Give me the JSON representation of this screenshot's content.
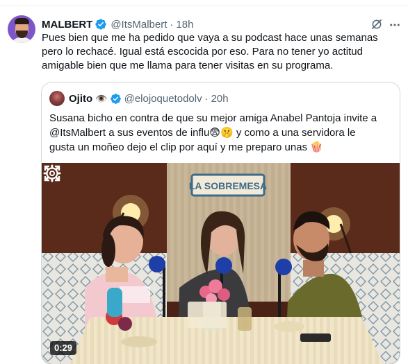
{
  "tweet": {
    "author_name": "MALBERT",
    "handle": "@ItsMalbert",
    "separator": "·",
    "time": "18h",
    "text": "Pues bien que me ha pedido que vaya a su podcast hace unas semanas\npero lo rechacé. Igual está escocida por eso. Para no tener yo actitud\namigable bien que me llama para tener visitas en su programa."
  },
  "quote": {
    "author_name": "Ojito",
    "name_emoji": "👁️",
    "handle": "@elojoquetodolv",
    "separator": "·",
    "time": "20h",
    "text": "Susana bicho en contra de que su mejor amiga Anabel Pantoja invite a\n@ItsMalbert a sus eventos de influ😨🤫 y como a una servidora le\ngusta un moñeo dejo el clip por aquí y me preparo unas 🍿",
    "video": {
      "sign_text": "LA SOBREMESA",
      "duration": "0:29"
    }
  },
  "colors": {
    "verified_blue": "#1d9bf0",
    "secondary_text": "#536471",
    "border": "#cfd9de"
  },
  "icons": [
    "verified-badge-icon",
    "grok-icon",
    "more-options-icon",
    "settings-gear-icon",
    "fullscreen-icon"
  ]
}
